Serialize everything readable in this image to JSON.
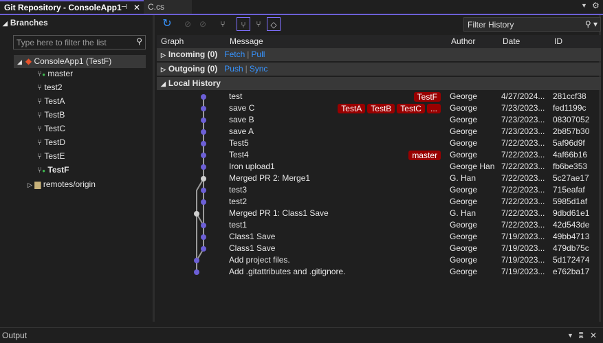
{
  "tabs": {
    "active": "Git Repository - ConsoleApp1",
    "other": "C.cs"
  },
  "branches": {
    "header": "Branches",
    "filter_placeholder": "Type here to filter the list",
    "repo": "ConsoleApp1 (TestF)",
    "items": [
      {
        "name": "master",
        "tracked": true,
        "bold": false
      },
      {
        "name": "test2"
      },
      {
        "name": "TestA"
      },
      {
        "name": "TestB"
      },
      {
        "name": "TestC"
      },
      {
        "name": "TestD"
      },
      {
        "name": "TestE"
      },
      {
        "name": "TestF",
        "tracked": true,
        "bold": true
      }
    ],
    "remotes": "remotes/origin"
  },
  "toolbar": {
    "filter_history": "Filter History"
  },
  "columns": {
    "graph": "Graph",
    "message": "Message",
    "author": "Author",
    "date": "Date",
    "id": "ID"
  },
  "incoming": {
    "label": "Incoming (0)",
    "fetch": "Fetch",
    "pull": "Pull"
  },
  "outgoing": {
    "label": "Outgoing (0)",
    "push": "Push",
    "sync": "Sync"
  },
  "local_history": "Local History",
  "commits": [
    {
      "msg": "test",
      "tags": [
        "TestF"
      ],
      "author": "George",
      "date": "4/27/2024...",
      "id": "281ccf38",
      "lane": 1,
      "merge": false
    },
    {
      "msg": "save C",
      "tags": [
        "TestA",
        "TestB",
        "TestC",
        "..."
      ],
      "author": "George",
      "date": "7/23/2023...",
      "id": "fed1199c",
      "lane": 1
    },
    {
      "msg": "save B",
      "tags": [],
      "author": "George",
      "date": "7/23/2023...",
      "id": "08307052",
      "lane": 1
    },
    {
      "msg": "save A",
      "tags": [],
      "author": "George",
      "date": "7/23/2023...",
      "id": "2b857b30",
      "lane": 1
    },
    {
      "msg": "Test5",
      "tags": [],
      "author": "George",
      "date": "7/22/2023...",
      "id": "5af96d9f",
      "lane": 1
    },
    {
      "msg": "Test4",
      "tags": [
        "master"
      ],
      "author": "George",
      "date": "7/22/2023...",
      "id": "4af66b16",
      "lane": 1
    },
    {
      "msg": "Iron upload1",
      "tags": [],
      "author": "George Han",
      "date": "7/22/2023...",
      "id": "fb6be353",
      "lane": 1
    },
    {
      "msg": "Merged PR 2: Merge1",
      "tags": [],
      "author": "G. Han",
      "date": "7/22/2023...",
      "id": "5c27ae17",
      "lane": 1,
      "merge": true
    },
    {
      "msg": "test3",
      "tags": [],
      "author": "George",
      "date": "7/22/2023...",
      "id": "715eafaf",
      "lane": 1
    },
    {
      "msg": "test2",
      "tags": [],
      "author": "George",
      "date": "7/22/2023...",
      "id": "5985d1af",
      "lane": 1
    },
    {
      "msg": "Merged PR 1: Class1 Save",
      "tags": [],
      "author": "G. Han",
      "date": "7/22/2023...",
      "id": "9dbd61e1",
      "lane": 0,
      "merge": true
    },
    {
      "msg": "test1",
      "tags": [],
      "author": "George",
      "date": "7/22/2023...",
      "id": "42d543de",
      "lane": 1
    },
    {
      "msg": "Class1 Save",
      "tags": [],
      "author": "George",
      "date": "7/19/2023...",
      "id": "49bb4713",
      "lane": 1
    },
    {
      "msg": "Class1 Save",
      "tags": [],
      "author": "George",
      "date": "7/19/2023...",
      "id": "479db75c",
      "lane": 1
    },
    {
      "msg": "Add project files.",
      "tags": [],
      "author": "George",
      "date": "7/19/2023...",
      "id": "5d172474",
      "lane": 0
    },
    {
      "msg": "Add .gitattributes and .gitignore.",
      "tags": [],
      "author": "George",
      "date": "7/19/2023...",
      "id": "e762ba17",
      "lane": 0
    }
  ],
  "edges": [
    [
      0,
      1
    ],
    [
      1,
      2
    ],
    [
      2,
      3
    ],
    [
      3,
      4
    ],
    [
      4,
      5
    ],
    [
      5,
      6
    ],
    [
      6,
      7
    ],
    [
      7,
      8
    ],
    [
      8,
      9
    ],
    [
      9,
      11
    ],
    [
      11,
      12
    ],
    [
      12,
      13
    ],
    [
      7,
      10
    ],
    [
      10,
      11
    ],
    [
      10,
      14
    ],
    [
      13,
      14
    ],
    [
      14,
      15
    ]
  ],
  "colors": {
    "node": "#6c5fd6",
    "merge_node": "#d0d0d0",
    "accent": "#6c5fd6",
    "badge": "#990000",
    "link": "#3794ff"
  },
  "output": {
    "title": "Output"
  }
}
